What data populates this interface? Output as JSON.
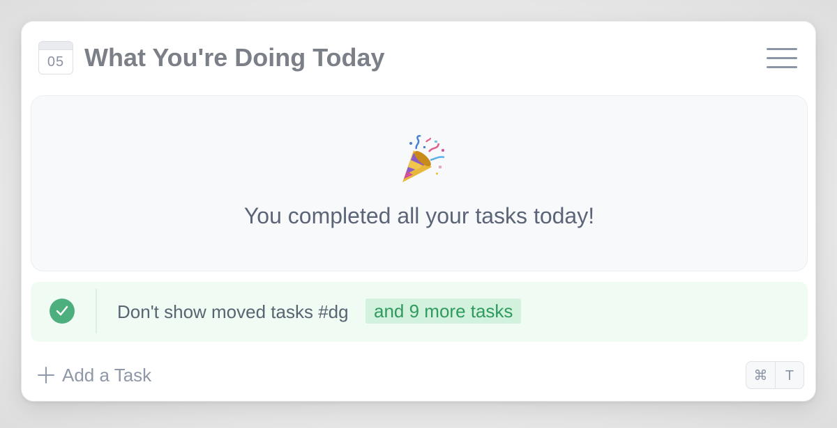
{
  "header": {
    "calendar_day": "05",
    "title": "What You're Doing Today",
    "menu_icon": "hamburger-menu-icon"
  },
  "empty_state": {
    "icon": "party-popper-icon",
    "message": "You completed all your tasks today!"
  },
  "completed_row": {
    "icon": "check-circle-icon",
    "task_text": "Don't show moved tasks #dg",
    "more_label": "and 9 more tasks"
  },
  "footer": {
    "add_task_label": "Add a Task",
    "shortcut_keys": [
      "⌘",
      "T"
    ]
  },
  "colors": {
    "accent_green": "#4caf7d",
    "pill_bg": "#d3f2de",
    "pill_text": "#2f9a5e",
    "title_gray": "#7b7f87"
  }
}
